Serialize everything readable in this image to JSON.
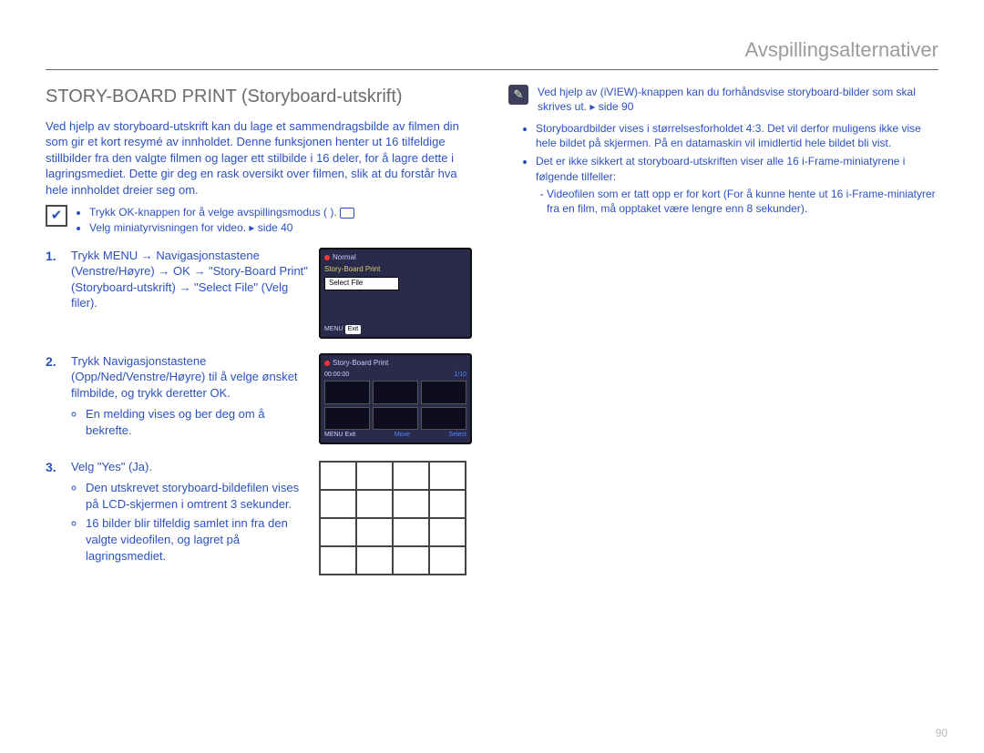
{
  "header": {
    "title": "Avspillingsalternativer"
  },
  "main": {
    "title": "STORY-BOARD PRINT (Storyboard-utskrift)",
    "intro": "Ved hjelp av storyboard-utskrift kan du lage et sammendragsbilde av filmen din som gir et kort resymé av innholdet. Denne funksjonen henter ut 16 tilfeldige stillbilder fra den valgte filmen og lager ett stilbilde i 16 deler, for å lagre dette i lagringsmediet. Dette gir deg en rask oversikt over filmen, slik at du forstår hva hele innholdet dreier seg om.",
    "pre_notes": {
      "items": [
        "Trykk OK-knappen for å velge avspillingsmodus (  ).",
        "Velg miniatyrvisningen for video. ▸ side 40"
      ]
    },
    "steps": [
      {
        "num": "1.",
        "text": "Trykk MENU → Navigasjonstastene (Venstre/Høyre) → OK → \"Story-Board Print\" (Storyboard-utskrift) → \"Select File\" (Velg filer).",
        "lcd": {
          "header": "Normal",
          "sub": "Story-Board Print",
          "select": "Select File",
          "footer_left": "MENU",
          "footer_right": "Exit"
        }
      },
      {
        "num": "2.",
        "text": "Trykk Navigasjonstastene (Opp/Ned/Venstre/Høyre) til å velge ønsket filmbilde, og trykk deretter OK.",
        "bullets": [
          "En melding vises og ber deg om å bekrefte."
        ],
        "lcd": {
          "header": "Story-Board Print",
          "time": "00:00:00",
          "count": "1/10",
          "footer_left": "MENU Exit",
          "footer_mid": "Move",
          "footer_right": "Select"
        }
      },
      {
        "num": "3.",
        "text": "Velg \"Yes\" (Ja).",
        "bullets": [
          "Den utskrevet storyboard-bildefilen vises på LCD-skjermen i omtrent 3 sekunder.",
          "16 bilder blir tilfeldig samlet inn fra den valgte videofilen, og lagret på lagringsmediet."
        ]
      }
    ]
  },
  "right": {
    "pencil_note": "Ved hjelp av (iVIEW)-knappen kan du forhåndsvise storyboard-bilder som skal skrives ut. ▸ side 90",
    "bullets": [
      "Storyboardbilder vises i størrelsesforholdet 4:3. Det vil derfor muligens ikke vise hele bildet på skjermen. På en datamaskin vil imidlertid hele bildet bli vist.",
      "Det er ikke sikkert at storyboard-utskriften viser alle 16 i-Frame-miniatyrene i følgende tilfeller:"
    ],
    "sub_bullets": [
      "Videofilen som er tatt opp er for kort (For å kunne hente ut 16 i-Frame-miniatyrer fra en film, må opptaket være lengre enn 8 sekunder)."
    ]
  },
  "page_num": "90"
}
